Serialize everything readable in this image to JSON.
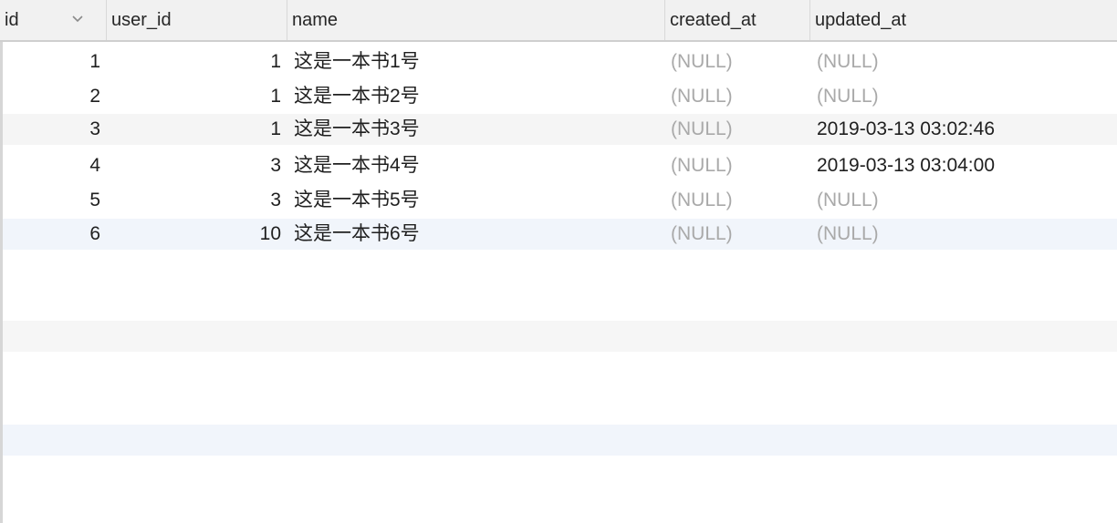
{
  "columns": {
    "id": "id",
    "user_id": "user_id",
    "name": "name",
    "created_at": "created_at",
    "updated_at": "updated_at"
  },
  "sort_icon": "chevron-down-icon",
  "rows": [
    {
      "id": "1",
      "user_id": "1",
      "name": "这是一本书1号",
      "created_at": "(NULL)",
      "updated_at": "(NULL)"
    },
    {
      "id": "2",
      "user_id": "1",
      "name": "这是一本书2号",
      "created_at": "(NULL)",
      "updated_at": "(NULL)"
    },
    {
      "id": "3",
      "user_id": "1",
      "name": "这是一本书3号",
      "created_at": "(NULL)",
      "updated_at": "2019-03-13 03:02:46"
    },
    {
      "id": "4",
      "user_id": "3",
      "name": "这是一本书4号",
      "created_at": "(NULL)",
      "updated_at": "2019-03-13 03:04:00"
    },
    {
      "id": "5",
      "user_id": "3",
      "name": "这是一本书5号",
      "created_at": "(NULL)",
      "updated_at": "(NULL)"
    },
    {
      "id": "6",
      "user_id": "10",
      "name": "这是一本书6号",
      "created_at": "(NULL)",
      "updated_at": "(NULL)"
    }
  ],
  "colors": {
    "header_bg": "#f1f1f1",
    "stripe": "#f5f5f5",
    "selected_row": "#f1f5fb",
    "null_text": "#a9a9a9"
  }
}
